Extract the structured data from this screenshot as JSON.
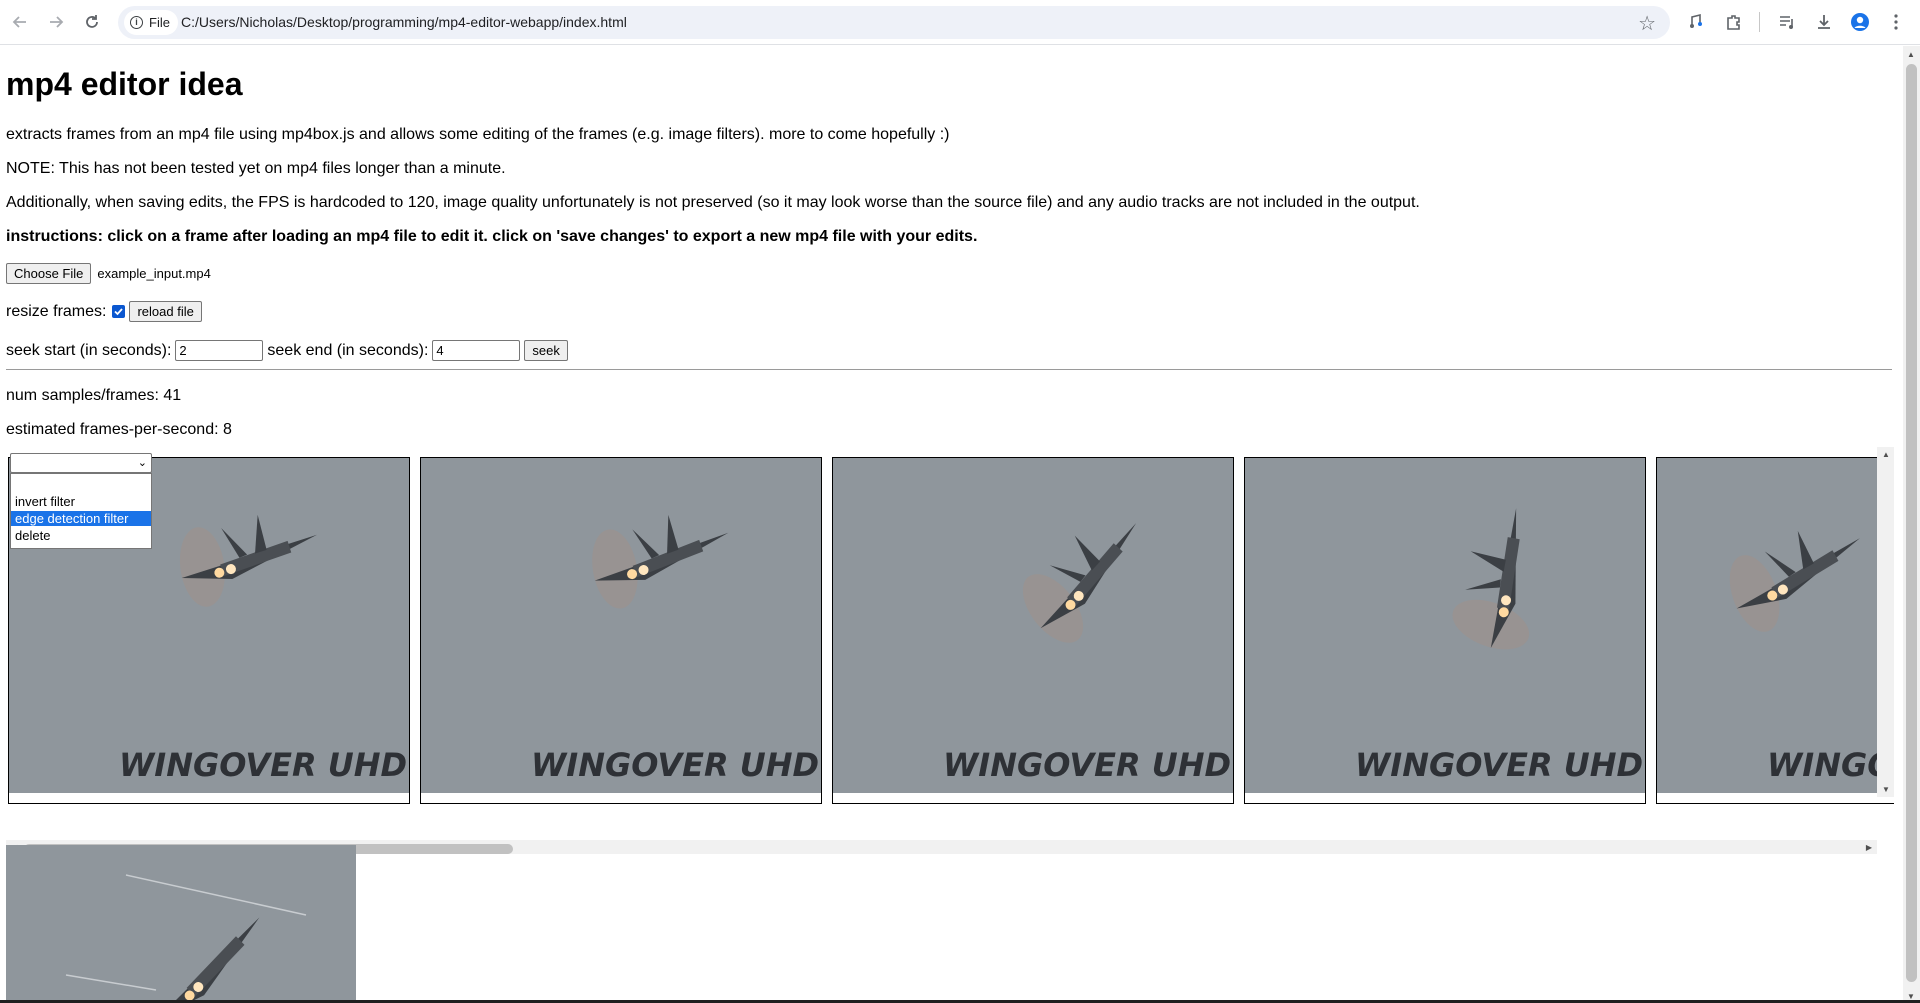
{
  "browser": {
    "site_label": "File",
    "url": "C:/Users/Nicholas/Desktop/programming/mp4-editor-webapp/index.html"
  },
  "page": {
    "title": "mp4 editor idea",
    "intro": "extracts frames from an mp4 file using mp4box.js and allows some editing of the frames (e.g. image filters). more to come hopefully :)",
    "note": "NOTE: This has not been tested yet on mp4 files longer than a minute.",
    "additional": "Additionally, when saving edits, the FPS is hardcoded to 120, image quality unfortunately is not preserved (so it may look worse than the source file) and any audio tracks are not included in the output.",
    "instructions": "instructions: click on a frame after loading an mp4 file to edit it. click on 'save changes' to export a new mp4 file with your edits.",
    "choose_file_label": "Choose File",
    "file_name": "example_input.mp4",
    "resize_label": "resize frames:",
    "resize_checked": true,
    "reload_label": "reload file",
    "seek_start_label": "seek start (in seconds):",
    "seek_start_value": "2",
    "seek_end_label": "seek end (in seconds):",
    "seek_end_value": "4",
    "seek_button": "seek",
    "num_samples": "num samples/frames: 41",
    "fps": "estimated frames-per-second: 8"
  },
  "dropdown": {
    "selected": "",
    "options": [
      "",
      "invert filter",
      "edge detection filter",
      "delete"
    ],
    "highlighted": "edge detection filter"
  },
  "frames": {
    "watermark": "WINGOVER UHD",
    "sky_color": "#8f969c"
  }
}
